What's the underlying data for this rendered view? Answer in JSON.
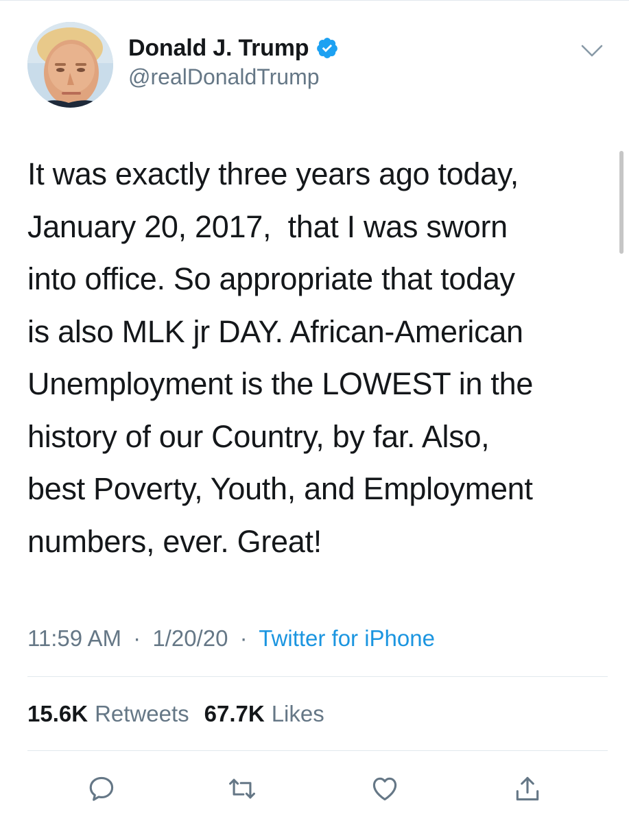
{
  "author": {
    "display_name": "Donald J. Trump",
    "handle": "@realDonaldTrump",
    "verified": true,
    "verified_color": "#1da1f2"
  },
  "tweet": {
    "text": "It was exactly three years ago today,\nJanuary 20, 2017,  that I was sworn\ninto office. So appropriate that today\nis also MLK jr DAY. African-American\nUnemployment is the LOWEST in the\nhistory of our Country, by far. Also,\nbest Poverty, Youth, and Employment\nnumbers, ever. Great!",
    "time": "11:59 AM",
    "separator": "·",
    "date": "1/20/20",
    "source": "Twitter for iPhone",
    "source_color": "#1b95e0"
  },
  "stats": {
    "retweets_count": "15.6K",
    "retweets_label": "Retweets",
    "likes_count": "67.7K",
    "likes_label": "Likes"
  },
  "icons": {
    "more": "chevron-down-icon",
    "reply": "reply-icon",
    "retweet": "retweet-icon",
    "like": "heart-icon",
    "share": "share-icon"
  }
}
